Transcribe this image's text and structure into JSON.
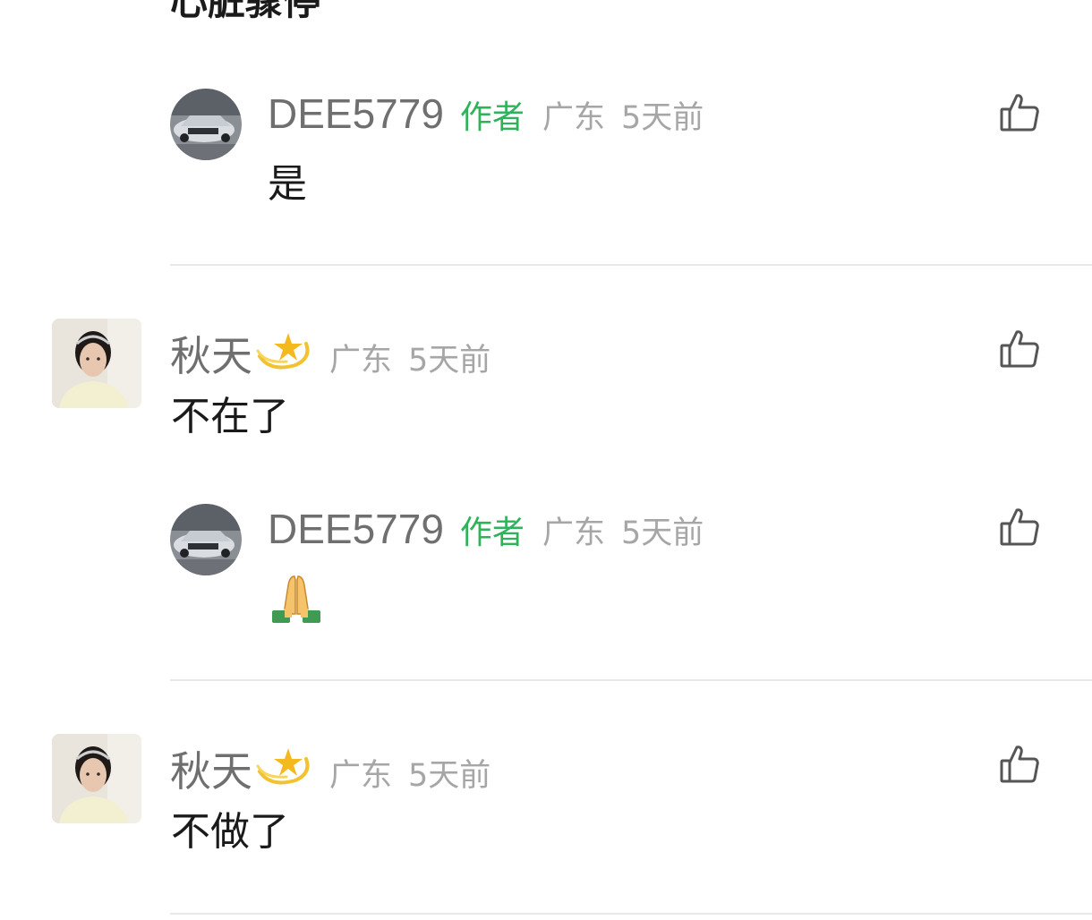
{
  "top_clipped_text": "心脏骤停",
  "comments": [
    {
      "username": "DEE5779",
      "badge": "作者",
      "location": "广东",
      "time": "5天前",
      "text": "是"
    },
    {
      "username": "秋天",
      "username_emoji": "dizzy-star-icon",
      "location": "广东",
      "time": "5天前",
      "text": "不在了"
    },
    {
      "username": "DEE5779",
      "badge": "作者",
      "location": "广东",
      "time": "5天前",
      "text_emoji": "folded-hands-icon"
    },
    {
      "username": "秋天",
      "username_emoji": "dizzy-star-icon",
      "location": "广东",
      "time": "5天前",
      "text": "不做了"
    }
  ],
  "colors": {
    "author_badge": "#2fb35a",
    "username": "#6f6f6f",
    "meta": "#a6a6a6",
    "text": "#1a1a1a",
    "divider": "#e8e8e8"
  }
}
